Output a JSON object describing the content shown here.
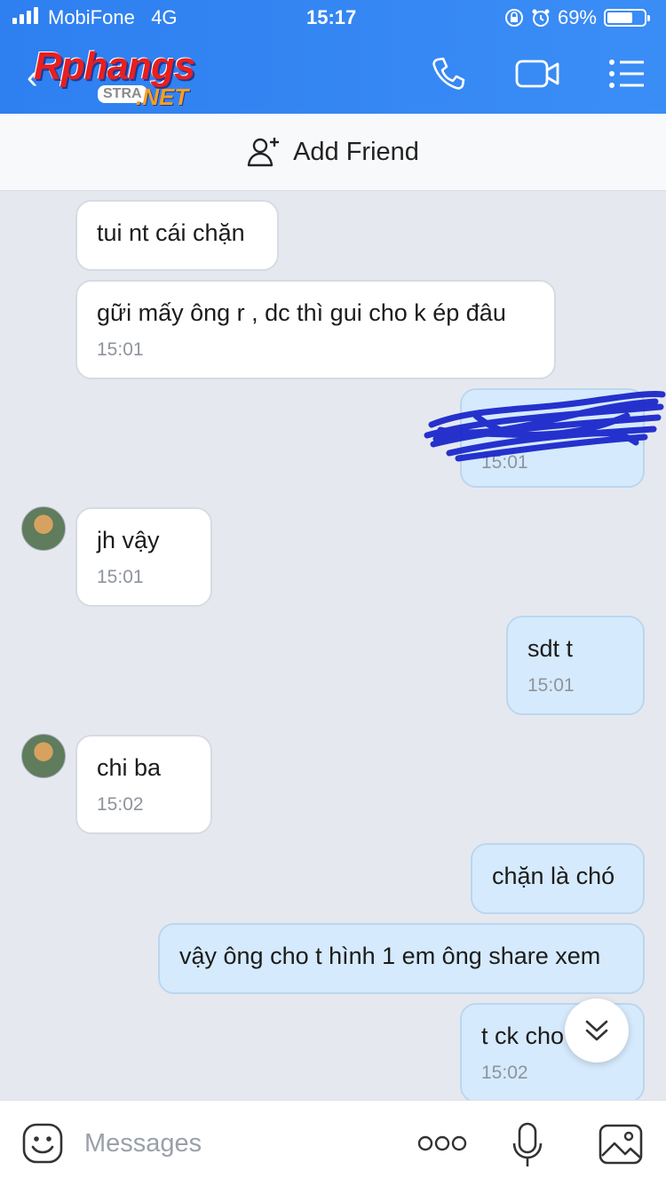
{
  "status_bar": {
    "carrier": "MobiFone",
    "network": "4G",
    "time": "15:17",
    "battery": "69%"
  },
  "header": {
    "logo_main": "Rphangs",
    "logo_badge": "STRA",
    "logo_suffix": ".NET"
  },
  "add_friend": {
    "label": "Add Friend"
  },
  "messages": [
    {
      "side": "them",
      "text": "tui nt cái chặn",
      "time": ""
    },
    {
      "side": "them",
      "text": "gữi mấy ông r , dc thì gui cho k ép đâu",
      "time": "15:01"
    },
    {
      "side": "me",
      "text": "",
      "time": "15:01"
    },
    {
      "side": "them",
      "text": "jh vậy",
      "time": "15:01"
    },
    {
      "side": "me",
      "text": "sdt t",
      "time": "15:01"
    },
    {
      "side": "them",
      "text": "chi ba",
      "time": "15:02"
    },
    {
      "side": "me",
      "text": "chặn là chó",
      "time": ""
    },
    {
      "side": "me",
      "text": "vậy ông cho t hình 1 em ông share xem",
      "time": ""
    },
    {
      "side": "me",
      "text": "t ck cho",
      "time": "15:02"
    }
  ],
  "input": {
    "placeholder": "Messages"
  },
  "colors": {
    "header_blue": "#3b8df6",
    "my_bubble": "#d5eafc",
    "their_bubble": "#ffffff",
    "chat_bg": "#e5e9ef"
  },
  "icons": [
    "phone-icon",
    "video-call-icon",
    "menu-icon",
    "add-friend-icon",
    "sticker-icon",
    "more-icon",
    "microphone-icon",
    "image-icon",
    "chevron-down-icon"
  ]
}
